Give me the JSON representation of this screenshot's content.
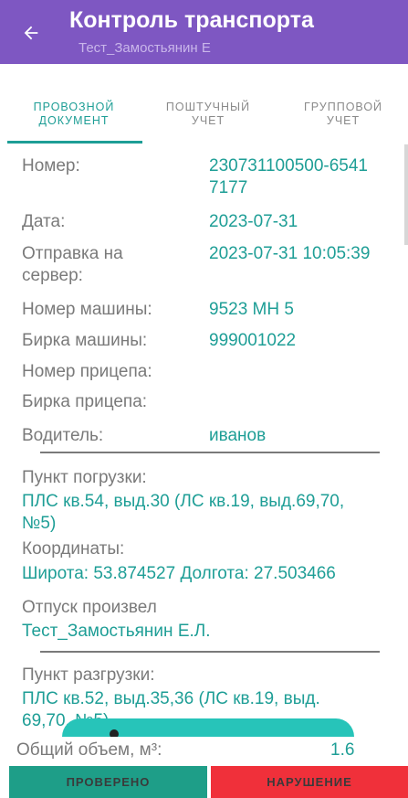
{
  "appbar": {
    "title": "Контроль транспорта",
    "subtitle": "Тест_Замостьянин Е",
    "back_icon": "arrow-back-icon"
  },
  "tabs": [
    {
      "line1": "ПРОВОЗНОЙ",
      "line2": "ДОКУМЕНТ",
      "active": true
    },
    {
      "line1": "ПОШТУЧНЫЙ",
      "line2": "УЧЕТ",
      "active": false
    },
    {
      "line1": "ГРУППОВОЙ",
      "line2": "УЧЕТ",
      "active": false
    }
  ],
  "fields": {
    "number": {
      "label": "Номер:",
      "value_line1": "230731100500-6541",
      "value_line2": "7177"
    },
    "date": {
      "label": "Дата:",
      "value": "2023-07-31"
    },
    "sent": {
      "label_line1": "Отправка на",
      "label_line2": "сервер:",
      "value": "2023-07-31 10:05:39"
    },
    "car_number": {
      "label": "Номер машины:",
      "value": "9523 МН 5"
    },
    "car_tag": {
      "label": "Бирка машины:",
      "value": "999001022"
    },
    "trailer_number": {
      "label": "Номер прицепа:"
    },
    "trailer_tag": {
      "label": "Бирка прицепа:"
    },
    "driver": {
      "label": "Водитель:",
      "value": "иванов"
    },
    "loading_point": {
      "label": "Пункт погрузки:",
      "value_line1": "ПЛС кв.54, выд.30 (ЛС кв.19, выд.69,70,",
      "value_line2": "№5)"
    },
    "coordinates": {
      "label": "Координаты:",
      "value": "Широта: 53.874527 Долгота: 27.503466"
    },
    "released_by": {
      "label": "Отпуск произвел",
      "value": "Тест_Замостьянин Е.Л."
    },
    "unloading_point": {
      "label": "Пункт разгрузки:",
      "value_line1": "ПЛС кв.52, выд.35,36 (ЛС кв.19, выд.",
      "value_line2": "69,70, №5)"
    }
  },
  "footer": {
    "total_label": "Общий объем, м³:",
    "total_value": "1.6"
  },
  "buttons": {
    "checked": "ПРОВЕРЕНО",
    "violation": "НАРУШЕНИЕ"
  },
  "colors": {
    "appbar": "#7e57c2",
    "accent": "#1e9e96",
    "checked_button": "#1e9e88",
    "violation_button": "#f0303a"
  }
}
